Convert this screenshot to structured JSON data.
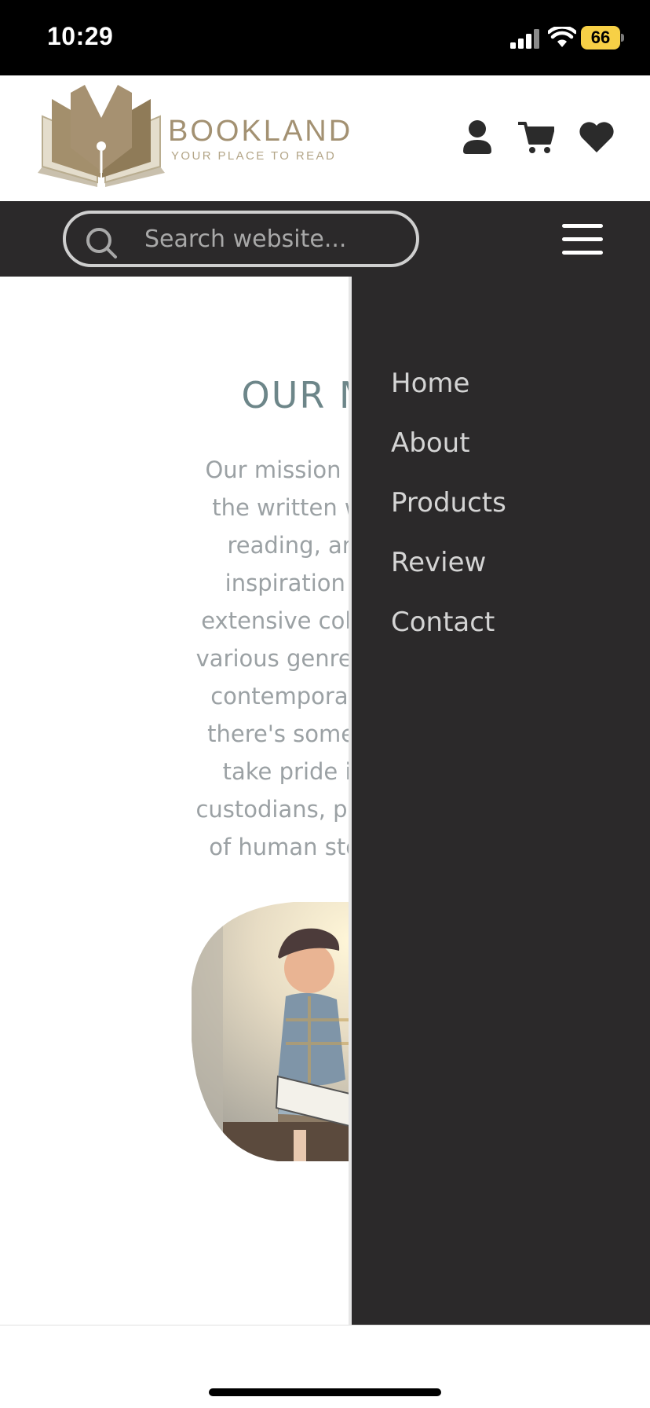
{
  "status_bar": {
    "time": "10:29",
    "battery": "66",
    "icons": [
      "signal-icon",
      "wifi-icon",
      "battery-icon"
    ]
  },
  "header": {
    "logo_name": "BOOKLAND",
    "logo_tagline": "YOUR PLACE TO READ",
    "icons": [
      "user-icon",
      "cart-icon",
      "heart-icon"
    ],
    "colors": {
      "logo": "#a39172",
      "icons": "#2b2b2b"
    }
  },
  "search": {
    "placeholder": "Search website...",
    "value": ""
  },
  "main": {
    "title": "OUR MIS",
    "mission_lines": [
      "Our mission is to con",
      "the written word, to",
      "reading, and to b",
      "inspiration for all.",
      "extensive collection o",
      "various genres, from ti",
      "contemporary bests",
      "there's something fo",
      "take pride in our r",
      "custodians, preserving",
      "of human stories thr"
    ]
  },
  "nav": {
    "items": [
      {
        "label": "Home"
      },
      {
        "label": "About"
      },
      {
        "label": "Products"
      },
      {
        "label": "Review"
      },
      {
        "label": "Contact"
      }
    ]
  },
  "colors": {
    "dark_bar": "#2b292a",
    "mission_title": "#6d8689",
    "mission_text": "#9ba1a4",
    "nav_text": "#d4d4d4",
    "battery": "#f7d046"
  }
}
